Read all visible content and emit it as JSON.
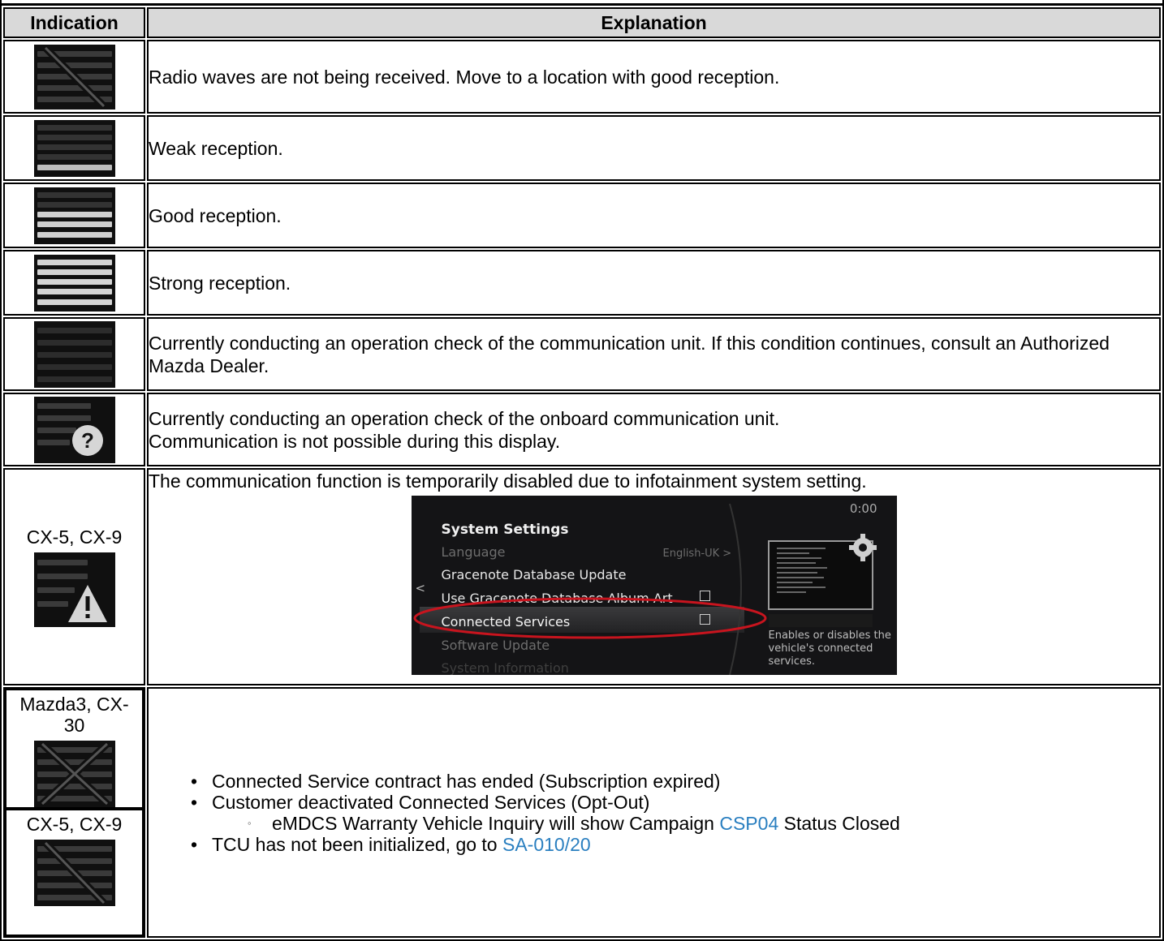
{
  "header": {
    "indication": "Indication",
    "explanation": "Explanation"
  },
  "rows": [
    {
      "icon": "signal-no-reception-icon",
      "text": "Radio waves are not being received. Move to a location with good reception."
    },
    {
      "icon": "signal-weak-icon",
      "text": "Weak reception."
    },
    {
      "icon": "signal-good-icon",
      "text": "Good reception."
    },
    {
      "icon": "signal-strong-icon",
      "text": "Strong reception."
    },
    {
      "icon": "signal-checking-icon",
      "text": "Currently conducting an operation check of the communication unit. If this condition continues, consult an Authorized Mazda Dealer."
    },
    {
      "icon": "signal-question-icon",
      "text_line1": "Currently conducting an operation check of the onboard communication unit.",
      "text_line2": "Communication is not possible during this display."
    },
    {
      "model": "CX-5, CX-9",
      "icon": "signal-warning-icon",
      "text": "The communication function is temporarily disabled due to infotainment system setting."
    }
  ],
  "screenshot": {
    "time": "0:00",
    "title": "System Settings",
    "language_label": "Language",
    "language_value": "English-UK >",
    "item_db_update": "Gracenote Database Update",
    "item_album_art": "Use Gracenote Database Album Art",
    "item_connected": "Connected Services",
    "item_software": "Software Update",
    "item_sysinfo": "System Information",
    "desc_line1": "Enables or disables the",
    "desc_line2": "vehicle's connected",
    "desc_line3": "services.",
    "back_glyph": "<"
  },
  "last_row": {
    "model_a": "Mazda3, CX-30",
    "model_a_icon": "signal-cross-icon",
    "model_b": "CX-5, CX-9",
    "model_b_icon": "signal-no-reception-icon",
    "bullet1": "Connected Service contract has ended (Subscription expired)",
    "bullet2": "Customer deactivated Connected Services (Opt-Out)",
    "sub_bullet_pre": "eMDCS Warranty Vehicle Inquiry will show Campaign ",
    "sub_bullet_link": "CSP04",
    "sub_bullet_post": " Status Closed",
    "bullet3_pre": "TCU has not been initialized, go to ",
    "bullet3_link": "SA-010/20"
  },
  "colors": {
    "header_bg": "#d9d9d9",
    "link": "#2a7fc0",
    "highlight_ellipse": "#c8141e"
  }
}
